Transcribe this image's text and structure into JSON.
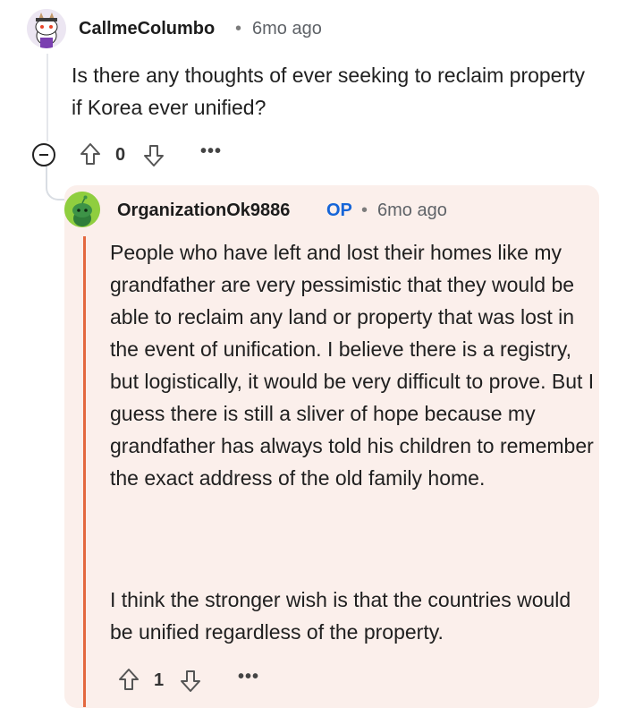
{
  "parent_comment": {
    "username": "CallmeColumbo",
    "separator": "•",
    "time": "6mo ago",
    "body": "Is there any thoughts of ever seeking to reclaim property if Korea ever unified?",
    "score": "0",
    "more_label": "•••",
    "avatar_icon": "snoo-avatar-icon",
    "collapse_icon": "collapse-minus-icon"
  },
  "reply": {
    "username": "OrganizationOk9886",
    "op_badge": "OP",
    "separator": "•",
    "time": "6mo ago",
    "body_p1": "People who have left and lost their homes like my grandfather are very pessimistic that they would be able to reclaim any land or property that was lost in the event of unification. I believe there is a registry, but logistically, it would be very difficult to prove. But I guess there is still a sliver of hope because my grandfather has always told his children to remember the exact address of the old family home.",
    "body_p2": "I think the stronger wish is that the countries would be unified regardless of the property.",
    "score": "1",
    "more_label": "•••",
    "avatar_icon": "snoo-avatar-icon",
    "highlight_color": "#fbefeb",
    "bar_color": "#e3683f",
    "op_color": "#1565d8"
  }
}
